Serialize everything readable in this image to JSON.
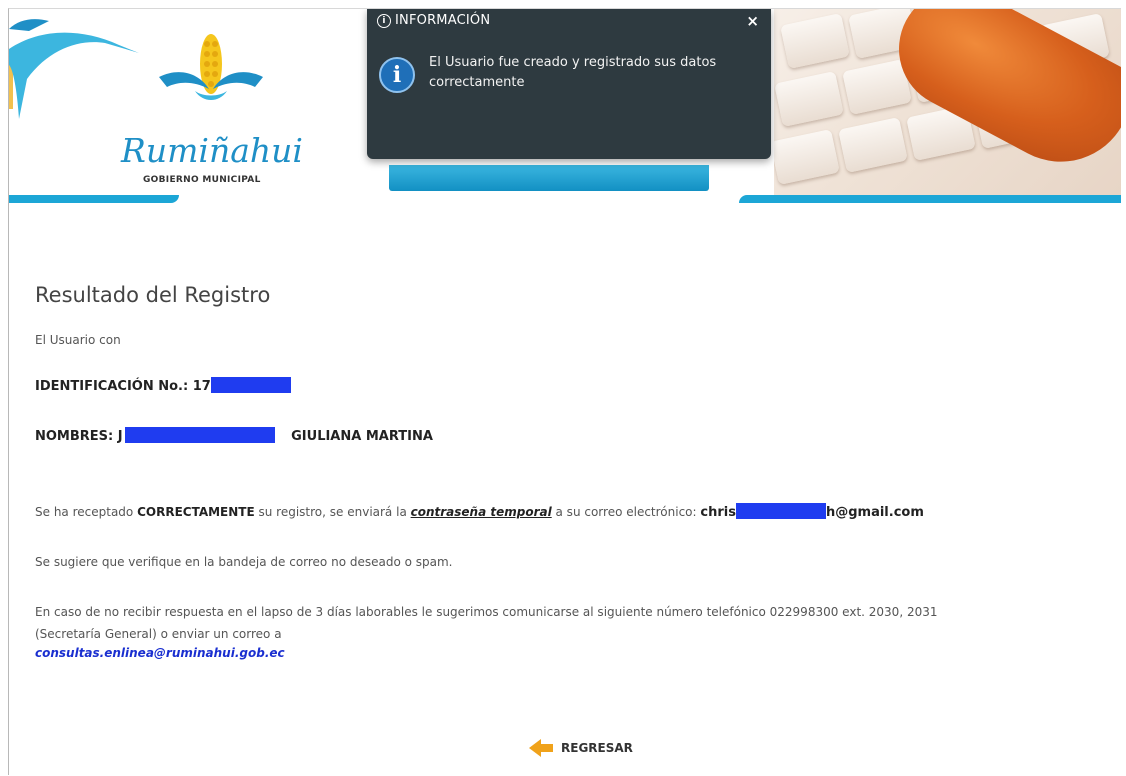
{
  "header": {
    "logo_name": "Rumiñahui",
    "logo_subtitle": "GOBIERNO MUNICIPAL"
  },
  "popup": {
    "title": "INFORMACIÓN",
    "close_glyph": "×",
    "message": "El Usuario fue creado y registrado sus datos correctamente",
    "icon": "info-icon"
  },
  "result": {
    "title": "Resultado del Registro",
    "intro": "El Usuario con",
    "id_label": "IDENTIFICACIÓN No.: 17",
    "names_label": "NOMBRES: J",
    "names_visible": "GIULIANA MARTINA",
    "received_prefix": "Se ha receptado ",
    "received_strong": "CORRECTAMENTE",
    "received_mid": " su registro, se enviará la ",
    "received_link": "contraseña temporal",
    "received_suffix": " a su correo electrónico: ",
    "email_start": "chris",
    "email_end": "h@gmail.com",
    "spam_note": "Se sugiere que verifique en la bandeja de correo no deseado o spam.",
    "contact_line1": "En caso de no recibir respuesta en el lapso de 3 días laborables le sugerimos comunicarse al siguiente número telefónico 022998300 ext. 2030, 2031",
    "contact_line2": "(Secretaría General) o enviar un correo a",
    "contact_email": "consultas.enlinea@ruminahui.gob.ec"
  },
  "actions": {
    "back_label": "REGRESAR"
  },
  "colors": {
    "accent_blue": "#1ca6d6",
    "popup_bg": "#2e3a40",
    "redaction": "#1f3cf0",
    "arrow": "#f0a21a"
  }
}
